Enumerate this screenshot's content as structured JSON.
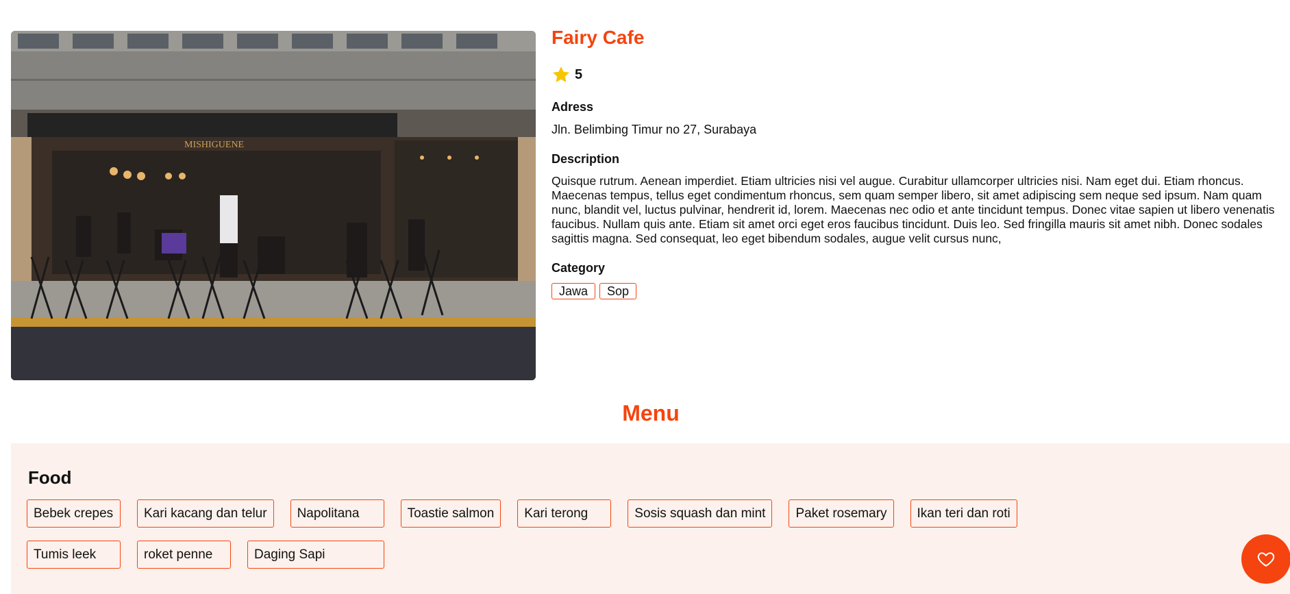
{
  "cafe": {
    "name": "Fairy Cafe",
    "rating": "5",
    "address_label": "Adress",
    "address": "Jln. Belimbing Timur no 27, Surabaya",
    "description_label": "Description",
    "description": "Quisque rutrum. Aenean imperdiet. Etiam ultricies nisi vel augue. Curabitur ullamcorper ultricies nisi. Nam eget dui. Etiam rhoncus. Maecenas tempus, tellus eget condimentum rhoncus, sem quam semper libero, sit amet adipiscing sem neque sed ipsum. Nam quam nunc, blandit vel, luctus pulvinar, hendrerit id, lorem. Maecenas nec odio et ante tincidunt tempus. Donec vitae sapien ut libero venenatis faucibus. Nullam quis ante. Etiam sit amet orci eget eros faucibus tincidunt. Duis leo. Sed fringilla mauris sit amet nibh. Donec sodales sagittis magna. Sed consequat, leo eget bibendum sodales, augue velit cursus nunc,",
    "category_label": "Category",
    "categories": [
      "Jawa",
      "Sop"
    ],
    "photo_sign": "MISHIGUENE"
  },
  "menu": {
    "title": "Menu",
    "food_title": "Food",
    "food": [
      "Bebek crepes",
      "Kari kacang dan telur",
      "Napolitana",
      "Toastie salmon",
      "Kari terong",
      "Sosis squash dan mint",
      "Paket rosemary",
      "Ikan teri dan roti",
      "Tumis leek",
      "roket penne",
      "Daging Sapi"
    ]
  },
  "colors": {
    "accent": "#f5440f",
    "menu_bg": "#fcf1ec",
    "star": "#f7c600"
  },
  "icons": {
    "rating": "star-icon",
    "favorite": "heart-icon"
  }
}
